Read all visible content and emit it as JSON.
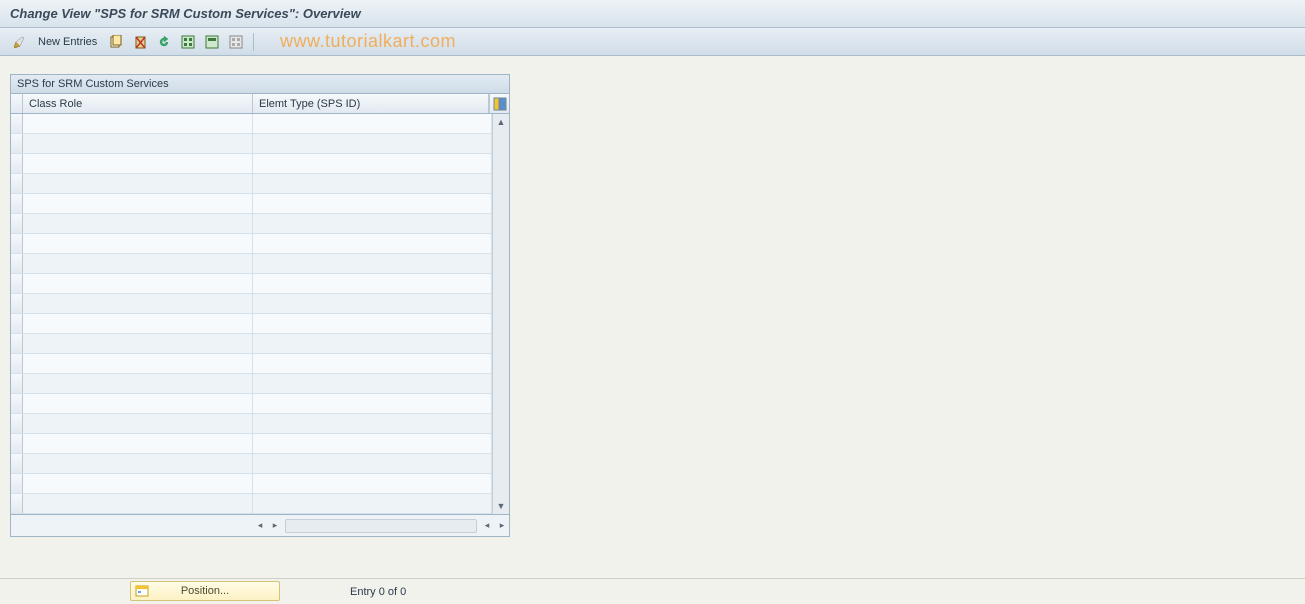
{
  "title": "Change View \"SPS for SRM Custom Services\": Overview",
  "toolbar": {
    "new_entries": "New Entries"
  },
  "watermark": "www.tutorialkart.com",
  "grid": {
    "title": "SPS for SRM Custom Services",
    "columns": {
      "class_role": "Class Role",
      "elemt_type": "Elemt Type (SPS ID)"
    },
    "rows": []
  },
  "footer": {
    "position": "Position...",
    "entry": "Entry 0 of 0"
  }
}
